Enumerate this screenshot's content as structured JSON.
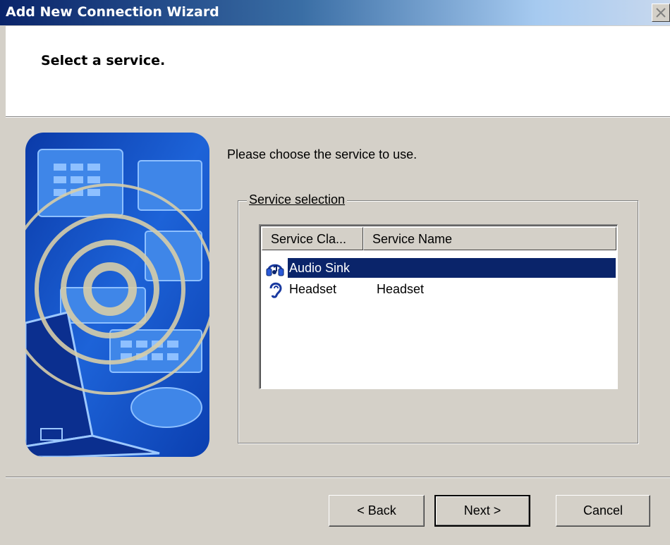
{
  "window": {
    "title": "Add New Connection Wizard"
  },
  "header": {
    "title": "Select a service."
  },
  "body": {
    "prompt": "Please choose the service to use.",
    "group_label": "Service selection"
  },
  "services_list": {
    "columns": [
      "Service Cla...",
      "Service Name"
    ],
    "rows": [
      {
        "class": "Audio Sink",
        "name": "",
        "icon": "headphones-icon",
        "selected": true
      },
      {
        "class": "Headset",
        "name": "Headset",
        "icon": "ear-icon",
        "selected": false
      }
    ]
  },
  "buttons": {
    "back": "< Back",
    "next": "Next >",
    "cancel": "Cancel"
  },
  "colors": {
    "selection": "#0a246a",
    "dialog": "#d4d0c8",
    "art_blue": "#1a5bd6"
  }
}
